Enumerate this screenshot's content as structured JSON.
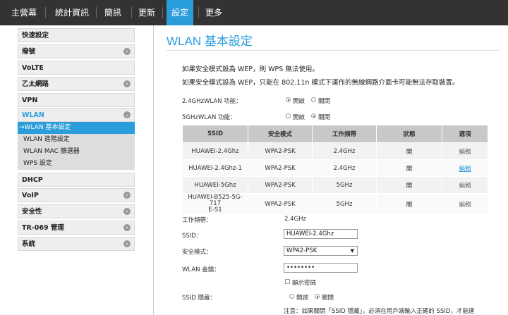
{
  "nav": {
    "items": [
      "主營幕",
      "統計資訊",
      "簡訊",
      "更新",
      "設定",
      "更多"
    ],
    "active": "設定"
  },
  "sidebar": {
    "items": [
      {
        "label": "快速設定"
      },
      {
        "label": "撥號"
      },
      {
        "label": "VoLTE"
      },
      {
        "label": "乙太網路"
      },
      {
        "label": "VPN"
      },
      {
        "label": "WLAN"
      },
      {
        "label": "DHCP"
      },
      {
        "label": "VoIP"
      },
      {
        "label": "安全性"
      },
      {
        "label": "TR-069 管理"
      },
      {
        "label": "系統"
      }
    ],
    "wlan_sub": [
      "→WLAN 基本設定",
      "WLAN 進階設定",
      "WLAN MAC 篩選器",
      "WPS 設定"
    ]
  },
  "page": {
    "title": "WLAN 基本設定",
    "note1": "如果安全模式設為 WEP，則 WPS 無法使用。",
    "note2": "如果安全模式設為 WEP，只能在 802.11n 模式下運作的無線網路介面卡可能無法存取裝置。",
    "wlan24_label": "2.4GHzWLAN 功能：",
    "wlan5_label": "5GHzWLAN 功能：",
    "on": "開啟",
    "off": "關閉"
  },
  "table": {
    "headers": [
      "SSID",
      "安全模式",
      "工作頻帶",
      "狀態",
      "選項"
    ],
    "rows": [
      [
        "HUAWEI-2.4Ghz",
        "WPA2-PSK",
        "2.4GHz",
        "開",
        "編輯"
      ],
      [
        "HUAWEI-2.4Ghz-1",
        "WPA2-PSK",
        "2.4GHz",
        "開",
        "編輯"
      ],
      [
        "HUAWEI-5Ghz",
        "WPA2-PSK",
        "5GHz",
        "開",
        "編輯"
      ],
      [
        "HUAWEI-B525-5G-717\nE-S1",
        "WPA2-PSK",
        "5GHz",
        "關",
        "編輯"
      ]
    ]
  },
  "form": {
    "band_label": "工作頻帶：",
    "band_value": "2.4GHz",
    "ssid_label": "SSID：",
    "ssid_value": "HUAWEI-2.4Ghz",
    "mode_label": "安全模式：",
    "mode_value": "WPA2-PSK",
    "key_label": "WLAN 金鑰：",
    "key_value": "••••••••",
    "show_pwd": "顯示密碼",
    "hide_label": "SSID 隱藏：",
    "hide_note": "注意：如果關閉「SSID 隱藏」，必須在用戶端輸入正確的 SSID，才能連"
  },
  "colors": {
    "accent": "#2a9ddb",
    "nav_bg": "#333333"
  }
}
